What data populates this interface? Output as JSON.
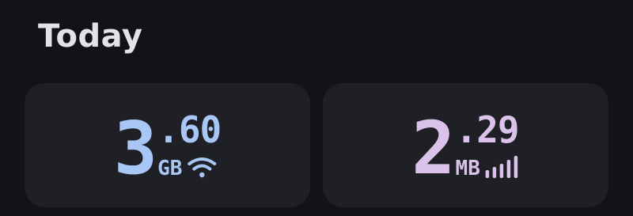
{
  "section": {
    "title": "Today"
  },
  "wifi_card": {
    "value_int": "3",
    "value_dec": ".60",
    "unit": "GB",
    "icon": "wifi-icon",
    "color": "#a9c7f6"
  },
  "mobile_card": {
    "value_int": "2",
    "value_dec": ".29",
    "unit": "MB",
    "icon": "cellular-signal-icon",
    "color": "#dbc2ea"
  },
  "colors": {
    "background": "#121317",
    "card": "#1f2026",
    "title": "#e3e3e7"
  }
}
